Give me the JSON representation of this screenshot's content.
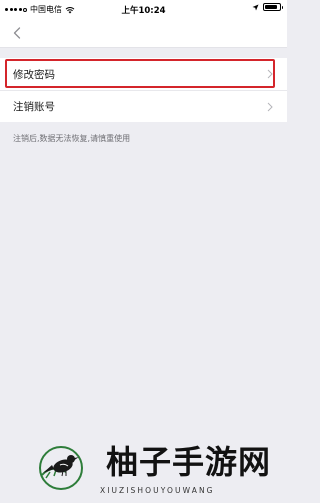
{
  "status_bar": {
    "carrier": "中国电信",
    "time": "上午10:24",
    "battery_level": 0.85
  },
  "menu": {
    "items": [
      {
        "label": "修改密码"
      },
      {
        "label": "注销账号"
      }
    ]
  },
  "notice": "注销后,数据无法恢复,请慎重使用",
  "watermark": {
    "title": "柚子手游网",
    "subtitle": "XIUZISHOUYOUWANG"
  },
  "colors": {
    "highlight": "#d4252b",
    "background": "#ededf2"
  }
}
